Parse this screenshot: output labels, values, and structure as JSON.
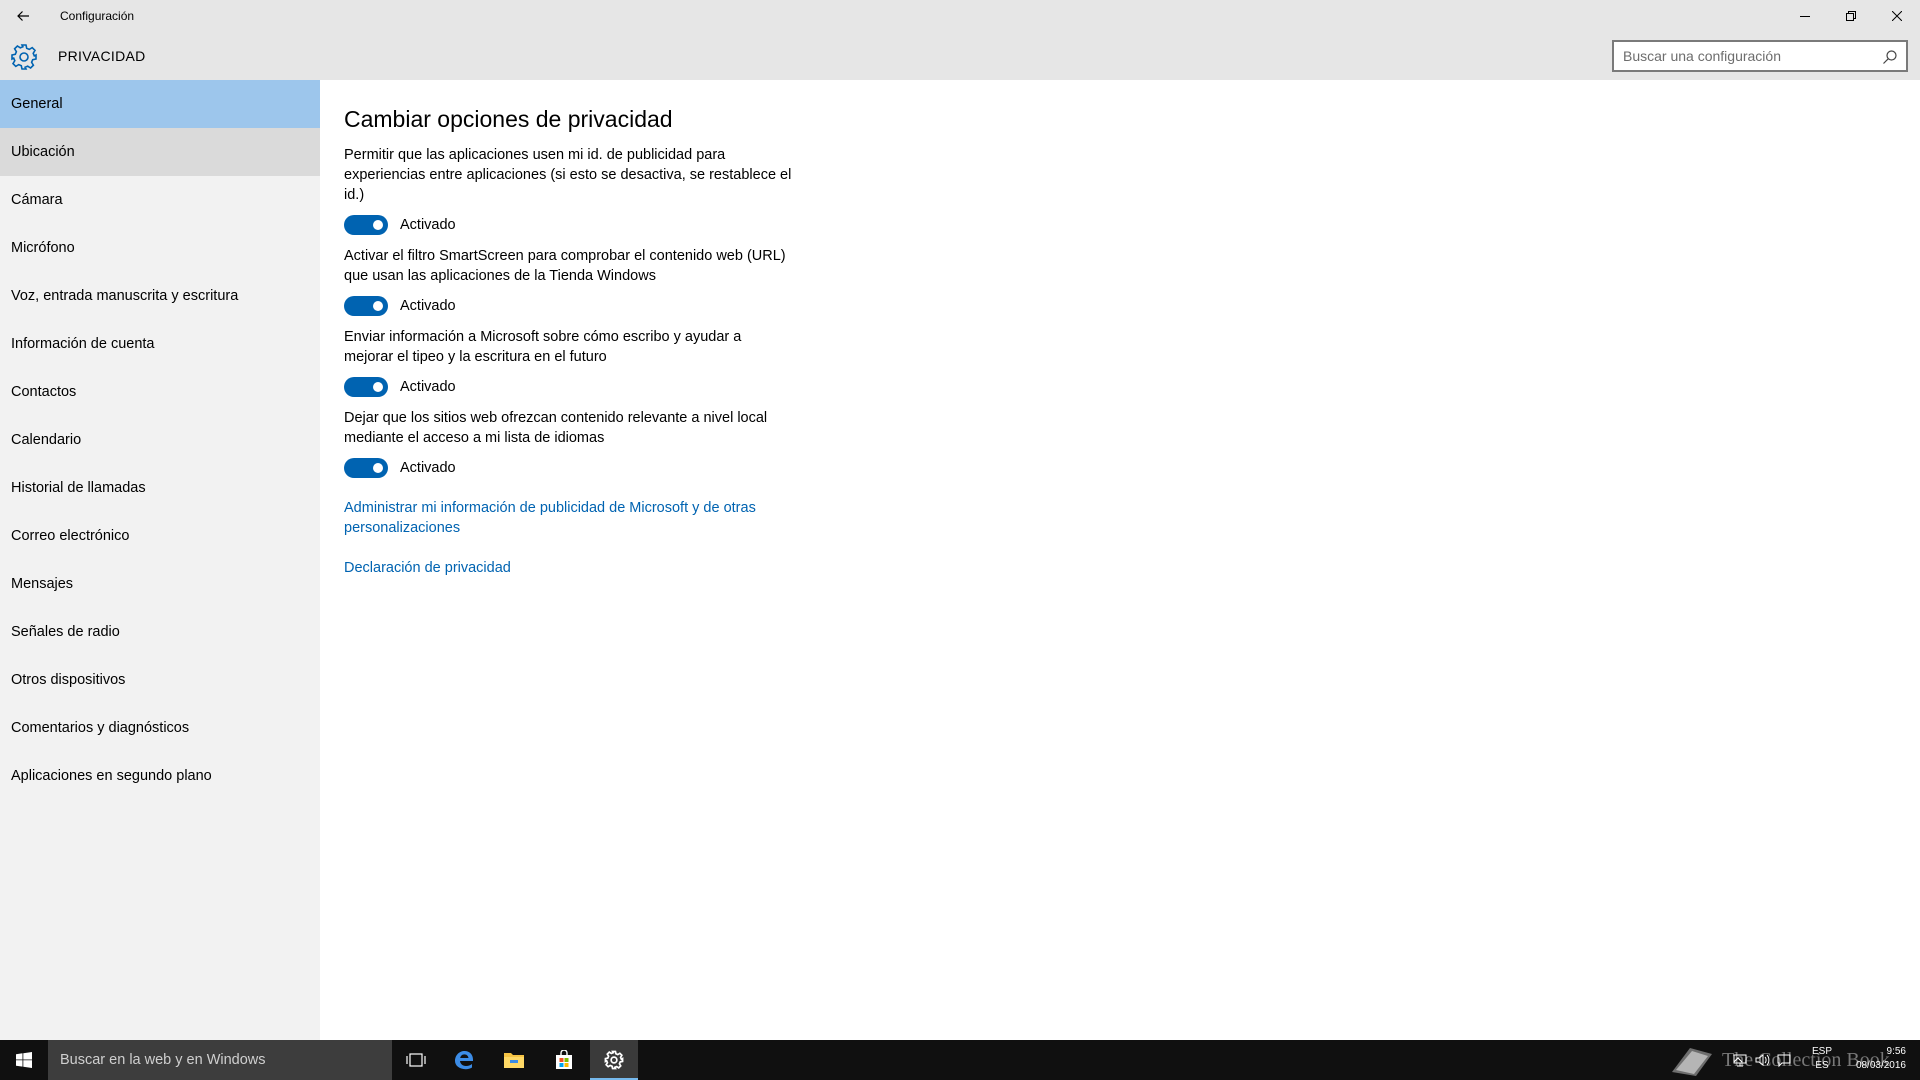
{
  "window": {
    "app_title": "Configuración"
  },
  "header": {
    "page_title": "PRIVACIDAD",
    "search_placeholder": "Buscar una configuración"
  },
  "sidebar": {
    "items": [
      {
        "label": "General",
        "state": "selected"
      },
      {
        "label": "Ubicación",
        "state": "hover"
      },
      {
        "label": "Cámara",
        "state": ""
      },
      {
        "label": "Micrófono",
        "state": ""
      },
      {
        "label": "Voz, entrada manuscrita y escritura",
        "state": ""
      },
      {
        "label": "Información de cuenta",
        "state": ""
      },
      {
        "label": "Contactos",
        "state": ""
      },
      {
        "label": "Calendario",
        "state": ""
      },
      {
        "label": "Historial de llamadas",
        "state": ""
      },
      {
        "label": "Correo electrónico",
        "state": ""
      },
      {
        "label": "Mensajes",
        "state": ""
      },
      {
        "label": "Señales de radio",
        "state": ""
      },
      {
        "label": "Otros dispositivos",
        "state": ""
      },
      {
        "label": "Comentarios y diagnósticos",
        "state": ""
      },
      {
        "label": "Aplicaciones en segundo plano",
        "state": ""
      }
    ]
  },
  "main": {
    "section_title": "Cambiar opciones de privacidad",
    "settings": [
      {
        "description": "Permitir que las aplicaciones usen mi id. de publicidad para experiencias entre aplicaciones (si esto se desactiva, se restablece el id.)",
        "toggle_label": "Activado",
        "on": true
      },
      {
        "description": "Activar el filtro SmartScreen para comprobar el contenido web (URL) que usan las aplicaciones de la Tienda Windows",
        "toggle_label": "Activado",
        "on": true
      },
      {
        "description": "Enviar información a Microsoft sobre cómo escribo y ayudar a mejorar el tipeo y la escritura en el futuro",
        "toggle_label": "Activado",
        "on": true
      },
      {
        "description": "Dejar que los sitios web ofrezcan contenido relevante a nivel local mediante el acceso a mi lista de idiomas",
        "toggle_label": "Activado",
        "on": true
      }
    ],
    "links": [
      "Administrar mi información de publicidad de Microsoft y de otras personalizaciones",
      "Declaración de privacidad"
    ]
  },
  "taskbar": {
    "search_text": "Buscar en la web y en Windows",
    "watermark": "The Collection Book",
    "lang_top": "ESP",
    "lang_bottom": "ES",
    "time": "9:56",
    "date": "08/03/2016"
  },
  "colors": {
    "accent": "#0063b1",
    "selected_nav": "#9dc6ec",
    "hover_nav": "#dadada",
    "chrome": "#e6e6e6",
    "sidebar": "#f2f2f2"
  }
}
